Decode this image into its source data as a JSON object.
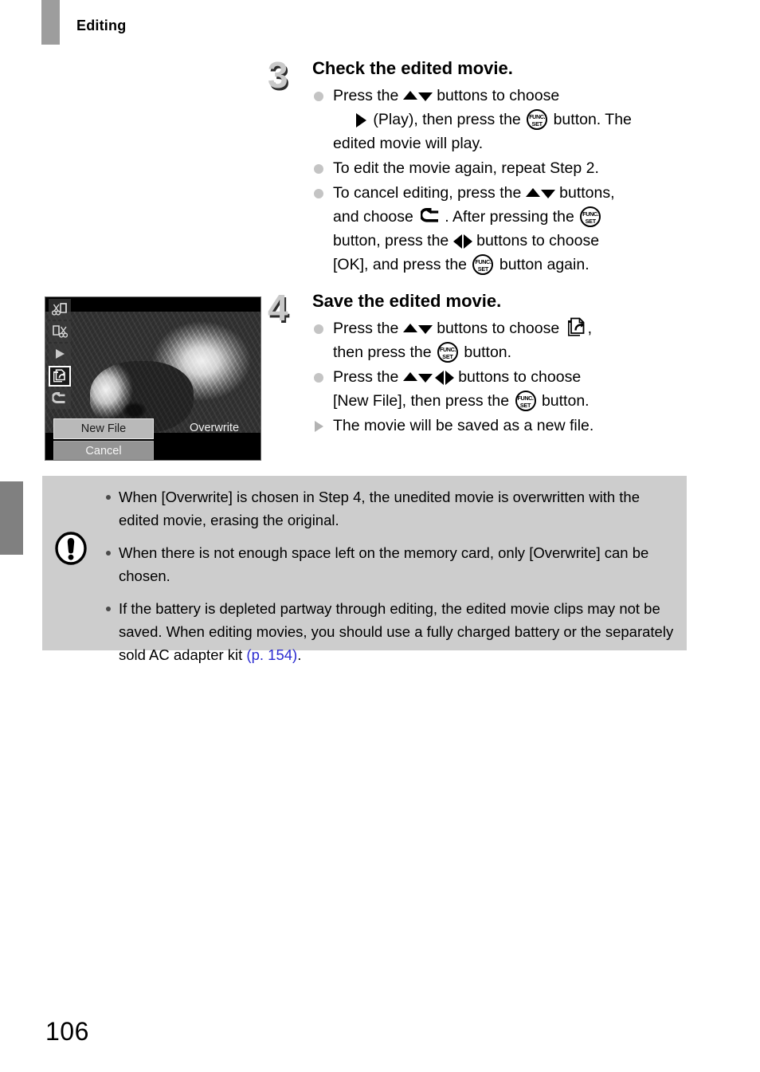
{
  "header": {
    "chapter_label": "Editing",
    "tab_color": "#9d9d9d"
  },
  "page": {
    "number": "106",
    "xref_color": "#2b2bd0",
    "note_box_color": "#cdcdcd"
  },
  "steps": [
    {
      "number": "3",
      "title": "Check the edited movie.",
      "bullets": [
        {
          "marker": "dot",
          "segments": [
            {
              "type": "text",
              "value": "Press the "
            },
            {
              "type": "icon",
              "value": "up-arrow-button-icon"
            },
            {
              "type": "icon",
              "value": "down-arrow-button-icon"
            },
            {
              "type": "text",
              "value": " buttons to choose"
            },
            {
              "type": "break"
            },
            {
              "type": "icon",
              "value": "play-triangle-icon"
            },
            {
              "type": "text",
              "value": " (Play), then press the "
            },
            {
              "type": "icon",
              "value": "func-set-button-icon"
            },
            {
              "type": "text",
              "value": " button. The edited movie will play."
            }
          ],
          "plain": "Press the up/down buttons to choose (Play), then press the FUNC./SET button. The edited movie will play."
        },
        {
          "marker": "dot",
          "plain": "To edit the movie again, repeat Step 2."
        },
        {
          "marker": "dot",
          "plain": "To cancel editing, press the up/down buttons, and choose the back arrow. After pressing the FUNC./SET button, press the left/right buttons to choose [OK], and press the FUNC./SET button again."
        }
      ]
    },
    {
      "number": "4",
      "title": "Save the edited movie.",
      "bullets": [
        {
          "marker": "dot",
          "plain": "Press the up/down buttons to choose the save-as-new-file icon, then press the FUNC./SET button."
        },
        {
          "marker": "dot",
          "plain": "Press the up/down/left/right buttons to choose [New File], then press the FUNC./SET button."
        },
        {
          "marker": "triangle",
          "plain": "The movie will be saved as a new file."
        }
      ]
    }
  ],
  "text_fragments": {
    "s3b1_a": "Press the ",
    "s3b1_b": " buttons to choose",
    "s3b1_c": " (Play), then press the ",
    "s3b1_d": " button. The",
    "s3b1_e": "edited movie will play.",
    "s3b2": "To edit the movie again, repeat Step 2.",
    "s3b3_a": "To cancel editing, press the ",
    "s3b3_b": " buttons,",
    "s3b3_c": "and choose ",
    "s3b3_d": ". After pressing the ",
    "s3b3_e": "button, press the ",
    "s3b3_f": " buttons to choose",
    "s3b3_g": "[OK], and press the ",
    "s3b3_h": " button again.",
    "s4b1_a": "Press the ",
    "s4b1_b": " buttons to choose ",
    "s4b1_c": ",",
    "s4b1_d": "then press the ",
    "s4b1_e": " button.",
    "s4b2_a": "Press the ",
    "s4b2_b": " buttons to choose",
    "s4b2_c": "[New File], then press the ",
    "s4b2_d": " button.",
    "s4b3": "The movie will be saved as a new file."
  },
  "func_set_icon": {
    "top_text": "FUNC.",
    "bottom_text": "SET"
  },
  "camera_screen": {
    "label": "movie-editing-panel-screenshot",
    "icons": [
      {
        "name": "trim-beginning-icon",
        "selected": false
      },
      {
        "name": "trim-end-icon",
        "selected": false
      },
      {
        "name": "play-preview-icon",
        "selected": false
      },
      {
        "name": "save-new-file-icon",
        "selected": true
      },
      {
        "name": "cancel-back-icon",
        "selected": false
      }
    ],
    "buttons": [
      {
        "label": "New File",
        "selected": true
      },
      {
        "label": "Overwrite",
        "selected": false
      },
      {
        "label": "Cancel",
        "selected": false
      }
    ]
  },
  "notes": [
    {
      "text": "When [Overwrite] is chosen in Step 4, the unedited movie is overwritten with the edited movie, erasing the original."
    },
    {
      "text": "When there is not enough space left on the memory card, only [Overwrite] can be chosen."
    },
    {
      "prefix": "If the battery is depleted partway through editing, the edited movie clips may not be saved. When editing movies, you should use a fully charged battery or the separately sold AC adapter kit ",
      "xref": "(p. 154)",
      "suffix": "."
    }
  ]
}
